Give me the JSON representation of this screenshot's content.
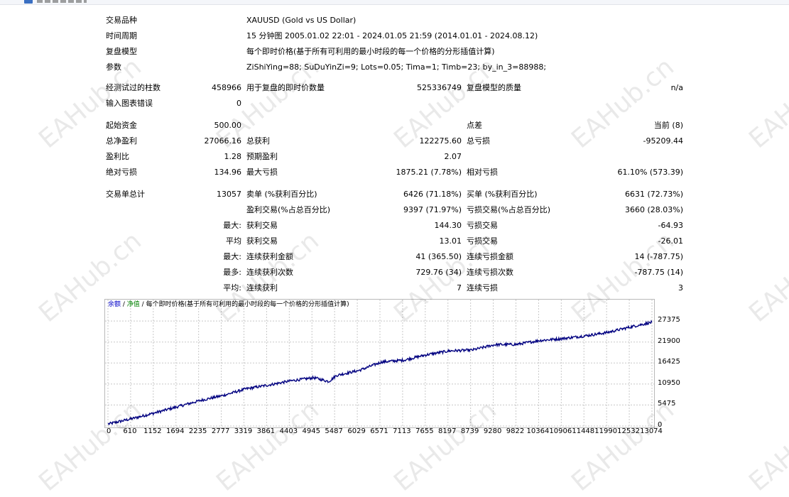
{
  "window": {
    "icon": "report-window-icon",
    "title": ""
  },
  "header": {
    "symbol": {
      "label": "交易品种",
      "value": "XAUUSD (Gold vs US Dollar)"
    },
    "period": {
      "label": "时间周期",
      "value": "15 分钟图 2005.01.02 22:01 - 2024.01.05 21:59 (2014.01.01 - 2024.08.12)"
    },
    "model": {
      "label": "复盘模型",
      "value": "每个即时价格(基于所有可利用的最小时段的每一个价格的分形插值计算)"
    },
    "params": {
      "label": "参数",
      "value": "ZiShiYing=88; SuDuYinZi=9; Lots=0.05; Tima=1; Timb=23; by_in_3=88988;"
    }
  },
  "stats": {
    "bars_tested": {
      "label": "经测试过的柱数",
      "value": "458966"
    },
    "ticks_modelled": {
      "label": "用于复盘的即时价数量",
      "value": "525336749"
    },
    "modelling_quality": {
      "label": "复盘模型的质量",
      "value": "n/a"
    },
    "mismatched_errors": {
      "label": "输入图表错误",
      "value": "0"
    },
    "initial_deposit": {
      "label": "起始资金",
      "value": "500.00"
    },
    "spread": {
      "label": "点差",
      "value": "当前 (8)"
    },
    "total_net_profit": {
      "label": "总净盈利",
      "value": "27066.16"
    },
    "gross_profit": {
      "label": "总获利",
      "value": "122275.60"
    },
    "gross_loss": {
      "label": "总亏损",
      "value": "-95209.44"
    },
    "profit_factor": {
      "label": "盈利比",
      "value": "1.28"
    },
    "expected_payoff": {
      "label": "预期盈利",
      "value": "2.07"
    },
    "absolute_drawdown": {
      "label": "绝对亏损",
      "value": "134.96"
    },
    "maximal_drawdown": {
      "label": "最大亏损",
      "value": "1875.21 (7.78%)"
    },
    "relative_drawdown": {
      "label": "相对亏损",
      "value": "61.10% (573.39)"
    },
    "total_trades": {
      "label": "交易单总计",
      "value": "13057"
    },
    "short_positions": {
      "label": "卖单 (%获利百分比)",
      "value": "6426 (71.18%)"
    },
    "long_positions": {
      "label": "买单 (%获利百分比)",
      "value": "6631 (72.73%)"
    },
    "profit_trades": {
      "label": "盈利交易(%占总百分比)",
      "value": "9397 (71.97%)"
    },
    "loss_trades": {
      "label": "亏损交易(%占总百分比)",
      "value": "3660 (28.03%)"
    },
    "largest_label": "最大:",
    "largest_profit": {
      "label": "获利交易",
      "value": "144.30"
    },
    "largest_loss": {
      "label": "亏损交易",
      "value": "-64.93"
    },
    "average_label": "平均",
    "average_profit": {
      "label": "获利交易",
      "value": "13.01"
    },
    "average_loss": {
      "label": "亏损交易",
      "value": "-26.01"
    },
    "max_label": "最大:",
    "max_consec_wins": {
      "label": "连续获利金额",
      "value": "41 (365.50)"
    },
    "max_consec_losses": {
      "label": "连续亏损金额",
      "value": "14 (-787.75)"
    },
    "maximal_label": "最多:",
    "maximal_consec_profit": {
      "label": "连续获利次数",
      "value": "729.76 (34)"
    },
    "maximal_consec_loss": {
      "label": "连续亏损次数",
      "value": "-787.75 (14)"
    },
    "avg_consec_label": "平均:",
    "avg_consec_wins": {
      "label": "连续获利",
      "value": "7"
    },
    "avg_consec_losses": {
      "label": "连续亏损",
      "value": "3"
    }
  },
  "watermark": "EAHub.cn",
  "chart_data": {
    "type": "line",
    "legend": {
      "balance": "余额",
      "separator": " / ",
      "equity": "净值",
      "separator2": " / ",
      "model": "每个即时价格(基于所有可利用的最小时段的每一个价格的分形插值计算)"
    },
    "colors": {
      "balance": "#000080",
      "equity": "#008000",
      "grid": "#c8c8c8"
    },
    "x_ticks": [
      "0",
      "610",
      "1152",
      "1694",
      "2235",
      "2777",
      "3319",
      "3861",
      "4403",
      "4945",
      "5487",
      "6029",
      "6571",
      "7113",
      "7655",
      "8197",
      "8739",
      "9280",
      "9822",
      "10364",
      "10906",
      "11448",
      "11990",
      "12532",
      "13074"
    ],
    "y_ticks": [
      "27375",
      "21900",
      "16425",
      "10950",
      "5475",
      "0"
    ],
    "xlim": [
      0,
      13057
    ],
    "ylim": [
      0,
      30000
    ],
    "grid": true,
    "series": [
      {
        "name": "余额",
        "x": [
          0,
          610,
          1152,
          1694,
          2235,
          2777,
          3319,
          3861,
          4403,
          4945,
          5300,
          5487,
          6029,
          6571,
          7113,
          7655,
          8197,
          8739,
          9280,
          9822,
          10364,
          10906,
          11448,
          11990,
          12532,
          13057
        ],
        "values": [
          500,
          2000,
          3500,
          5100,
          6700,
          8000,
          9700,
          10700,
          11800,
          12600,
          11600,
          13200,
          14500,
          16700,
          17200,
          18600,
          19600,
          19800,
          21200,
          21300,
          22300,
          22800,
          23500,
          24400,
          25800,
          27066
        ]
      }
    ]
  }
}
